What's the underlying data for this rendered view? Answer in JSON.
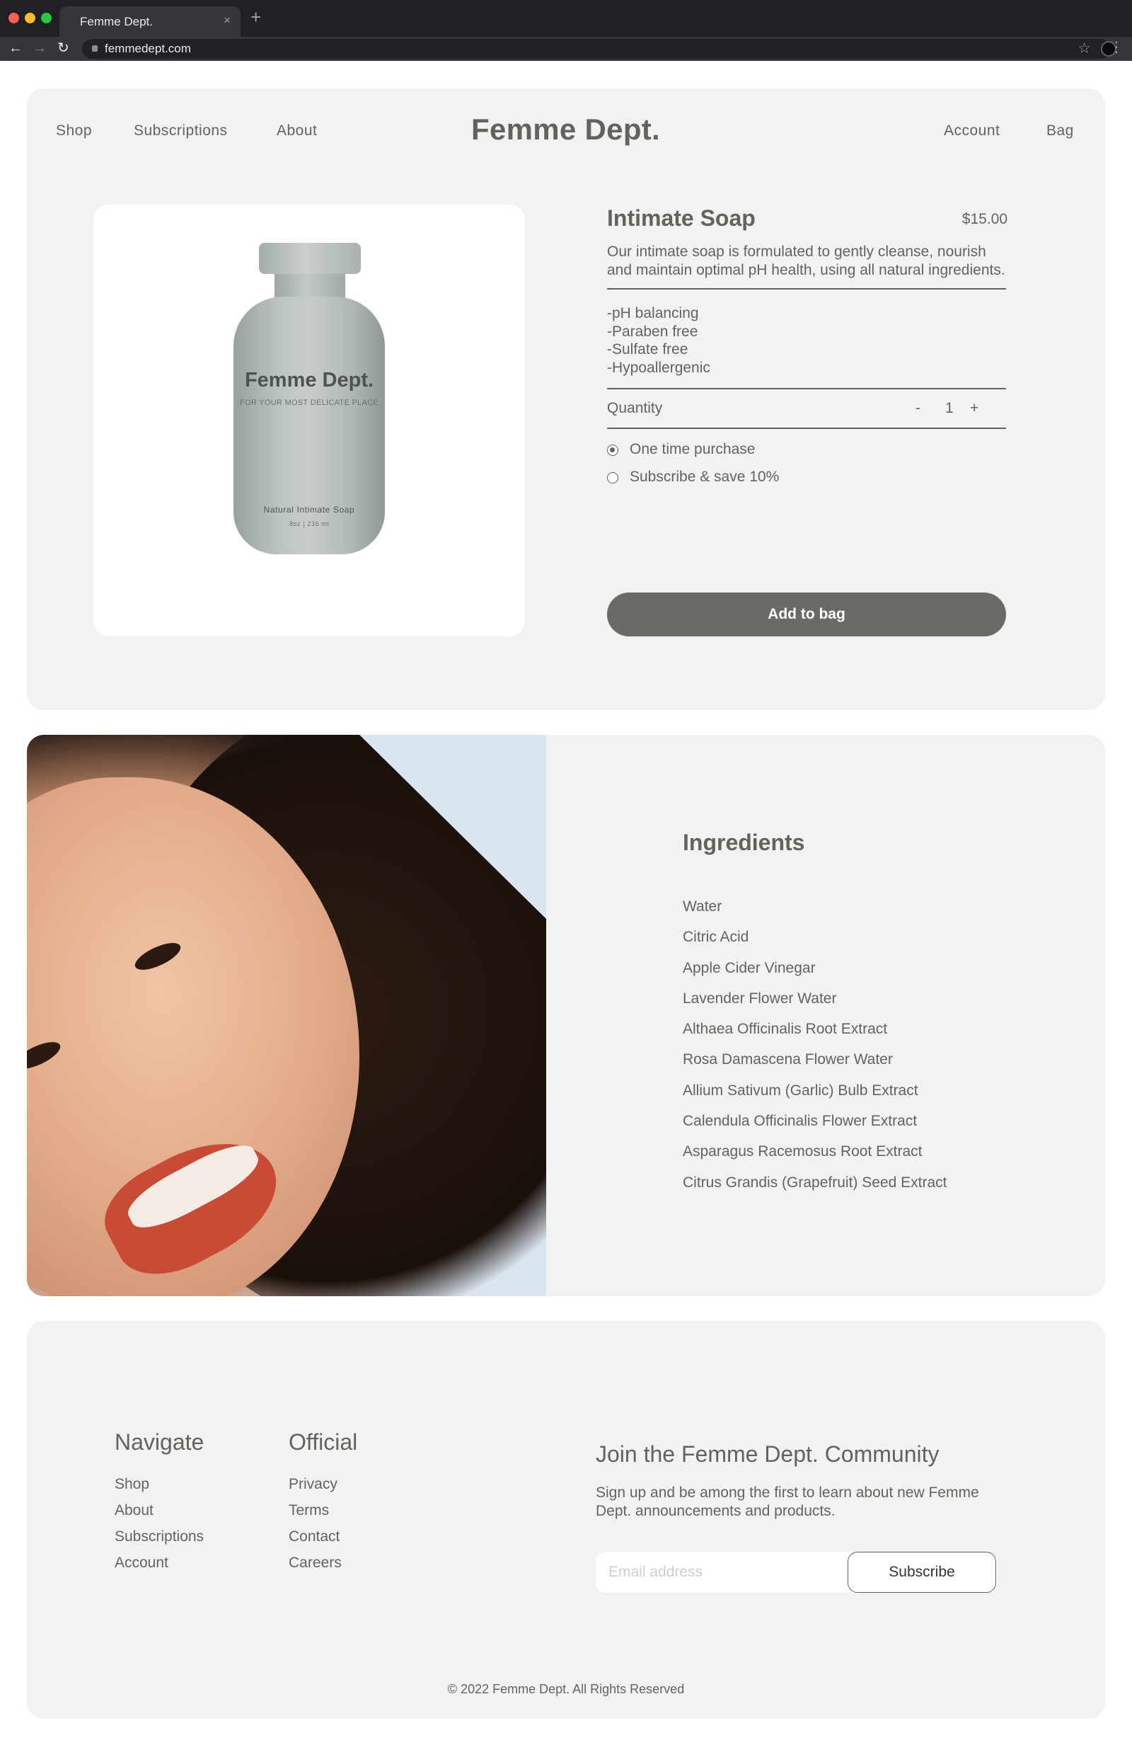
{
  "browser": {
    "tab_title": "Femme Dept.",
    "tab_close": "×",
    "new_tab": "+",
    "url": "femmedept.com",
    "icons": [
      "back-arrow-icon",
      "forward-arrow-icon",
      "reload-icon",
      "lock-icon",
      "star-icon",
      "profile-avatar",
      "kebab-menu-icon"
    ]
  },
  "header": {
    "nav_left": [
      "Shop",
      "Subscriptions",
      "About"
    ],
    "brand": "Femme Dept.",
    "nav_right": [
      "Account",
      "Bag"
    ]
  },
  "product": {
    "image": {
      "brand": "Femme Dept.",
      "tagline": "FOR YOUR MOST DELICATE PLACE",
      "name": "Natural Intimate Soap",
      "size": "8oz | 236 ml"
    },
    "title": "Intimate Soap",
    "price": "$15.00",
    "description": "Our intimate soap is formulated to gently cleanse, nourish and maintain optimal pH health, using all natural ingredients.",
    "features": [
      "-pH balancing",
      "-Paraben free",
      "-Sulfate free",
      "-Hypoallergenic"
    ],
    "quantity": {
      "label": "Quantity",
      "minus": "-",
      "value": "1",
      "plus": "+"
    },
    "purchase_options": [
      {
        "label": "One time purchase",
        "selected": true
      },
      {
        "label": "Subscribe & save 10%",
        "selected": false
      }
    ],
    "add_to_bag": "Add to bag"
  },
  "ingredients": {
    "title": "Ingredients",
    "items": [
      "Water",
      "Citric Acid",
      "Apple Cider Vinegar",
      "Lavender Flower Water",
      "Althaea Officinalis Root Extract",
      "Rosa Damascena Flower Water",
      "Allium Sativum (Garlic) Bulb Extract",
      "Calendula Officinalis Flower Extract",
      "Asparagus Racemosus Root Extract",
      "Citrus Grandis (Grapefruit) Seed Extract"
    ]
  },
  "footer": {
    "navigate": {
      "heading": "Navigate",
      "links": [
        "Shop",
        "About",
        "Subscriptions",
        "Account"
      ]
    },
    "official": {
      "heading": "Official",
      "links": [
        "Privacy",
        "Terms",
        "Contact",
        "Careers"
      ]
    },
    "newsletter": {
      "title": "Join the Femme Dept. Community",
      "text": "Sign up and be among the first to learn about new Femme Dept. announcements and products.",
      "email_placeholder": "Email address",
      "email_value": "",
      "subscribe": "Subscribe"
    },
    "copyright": "© 2022 Femme Dept. All Rights Reserved"
  },
  "colors": {
    "text": "#63635d",
    "card_bg": "#f1f3f2",
    "button_bg": "#6b6a64",
    "chrome_bg": "#202124"
  }
}
